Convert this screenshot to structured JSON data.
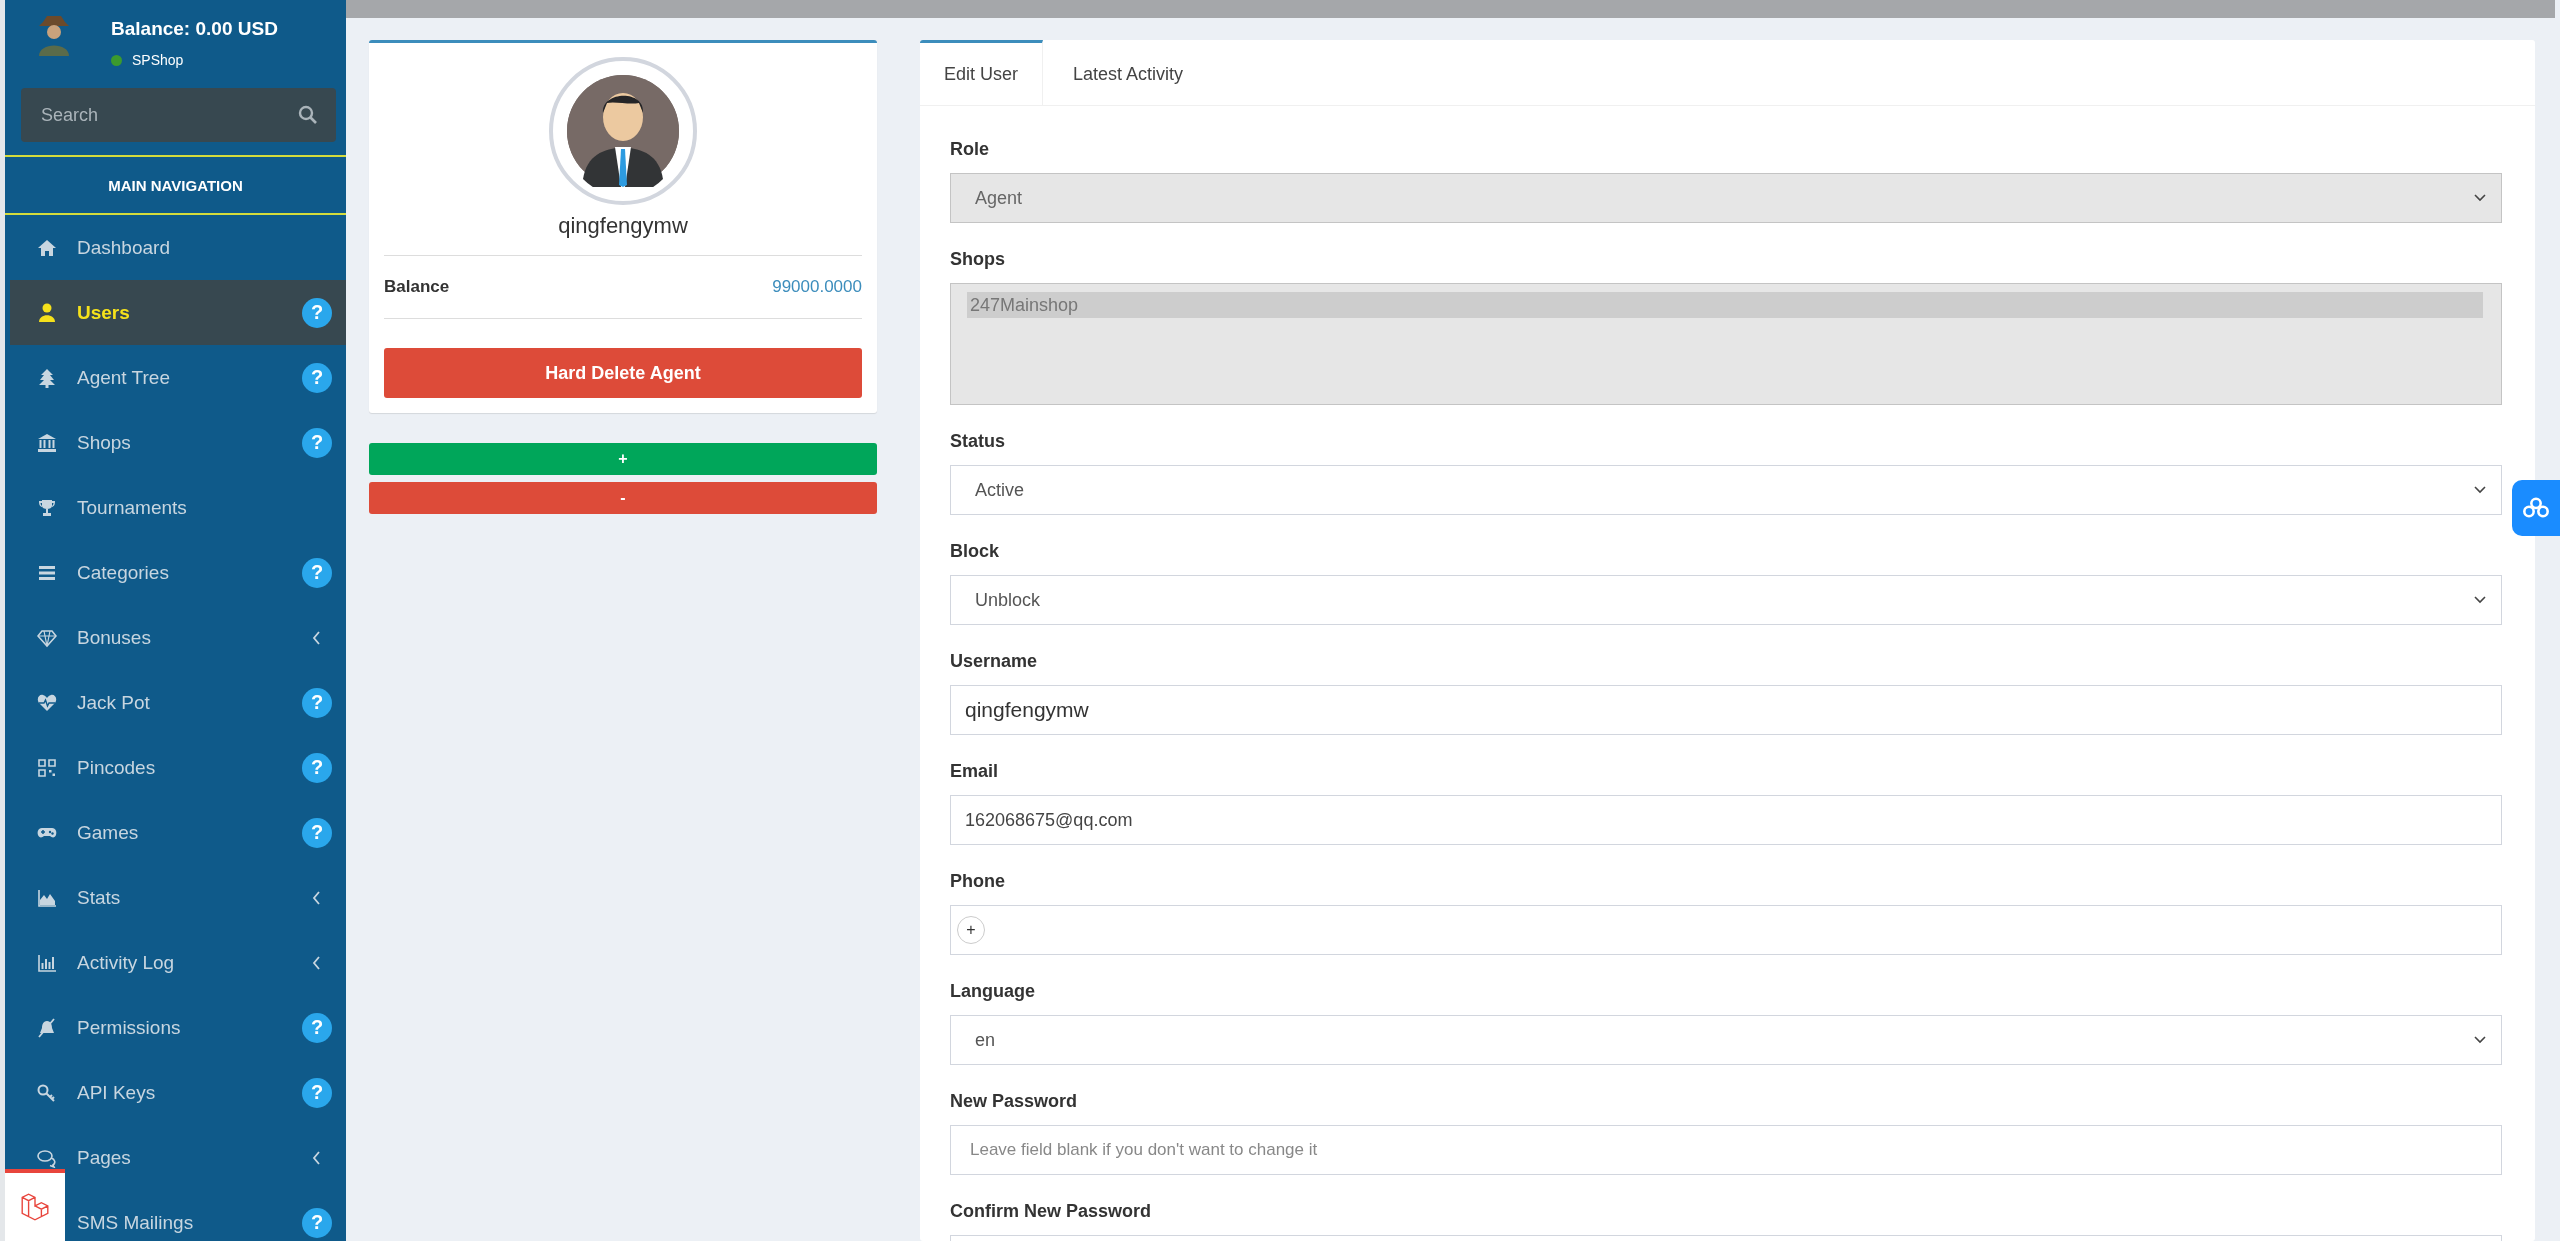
{
  "sidebar": {
    "balance": "Balance: 0.00 USD",
    "shop": "SPShop",
    "online": true,
    "search": {
      "placeholder": "Search"
    },
    "section": "MAIN NAVIGATION",
    "items": [
      {
        "label": "Dashboard",
        "submenu": false,
        "selected": false
      },
      {
        "label": "Users",
        "badge": "?",
        "submenu": false,
        "selected": true
      },
      {
        "label": "Agent Tree",
        "badge": "?",
        "submenu": false,
        "selected": false
      },
      {
        "label": "Shops",
        "badge": "?",
        "submenu": false,
        "selected": false
      },
      {
        "label": "Tournaments",
        "submenu": false,
        "selected": false
      },
      {
        "label": "Categories",
        "badge": "?",
        "submenu": false,
        "selected": false
      },
      {
        "label": "Bonuses",
        "submenu": true,
        "selected": false
      },
      {
        "label": "Jack Pot",
        "badge": "?",
        "submenu": false,
        "selected": false
      },
      {
        "label": "Pincodes",
        "badge": "?",
        "submenu": false,
        "selected": false
      },
      {
        "label": "Games",
        "badge": "?",
        "submenu": false,
        "selected": false
      },
      {
        "label": "Stats",
        "submenu": true,
        "selected": false
      },
      {
        "label": "Activity Log",
        "submenu": true,
        "selected": false
      },
      {
        "label": "Permissions",
        "badge": "?",
        "submenu": false,
        "selected": false
      },
      {
        "label": "API Keys",
        "badge": "?",
        "submenu": false,
        "selected": false
      },
      {
        "label": "Pages",
        "submenu": true,
        "selected": false
      },
      {
        "label": "SMS Mailings",
        "badge": "?",
        "submenu": false,
        "selected": false
      }
    ]
  },
  "profile": {
    "username": "qingfengymw",
    "balance_label": "Balance",
    "balance": "99000.0000",
    "delete_button": "Hard Delete Agent",
    "add_button": "+",
    "subtract_button": "-"
  },
  "tabs": [
    {
      "label": "Edit User",
      "selected": true
    },
    {
      "label": "Latest Activity",
      "selected": false
    }
  ],
  "form": {
    "fields": [
      {
        "label": "Role",
        "kind": "select",
        "value": "Agent",
        "disabled": true
      },
      {
        "label": "Shops",
        "kind": "multiselect",
        "disabled": true,
        "options": [
          {
            "label": "247Mainshop",
            "selected": true
          }
        ]
      },
      {
        "label": "Status",
        "kind": "select",
        "value": "Active",
        "disabled": false
      },
      {
        "label": "Block",
        "kind": "select",
        "value": "Unblock",
        "disabled": false
      },
      {
        "label": "Username",
        "kind": "text",
        "value": "qingfengymw",
        "disabled": false
      },
      {
        "label": "Email",
        "kind": "text",
        "value": "162068675@qq.com",
        "disabled": false
      },
      {
        "label": "Phone",
        "kind": "phone",
        "prefix": "+",
        "disabled": false
      },
      {
        "label": "Language",
        "kind": "select",
        "value": "en",
        "disabled": false
      },
      {
        "label": "New Password",
        "kind": "password",
        "placeholder": "Leave field blank if you don't want to change it",
        "disabled": false
      },
      {
        "label": "Confirm New Password",
        "kind": "password",
        "disabled": false
      }
    ]
  }
}
